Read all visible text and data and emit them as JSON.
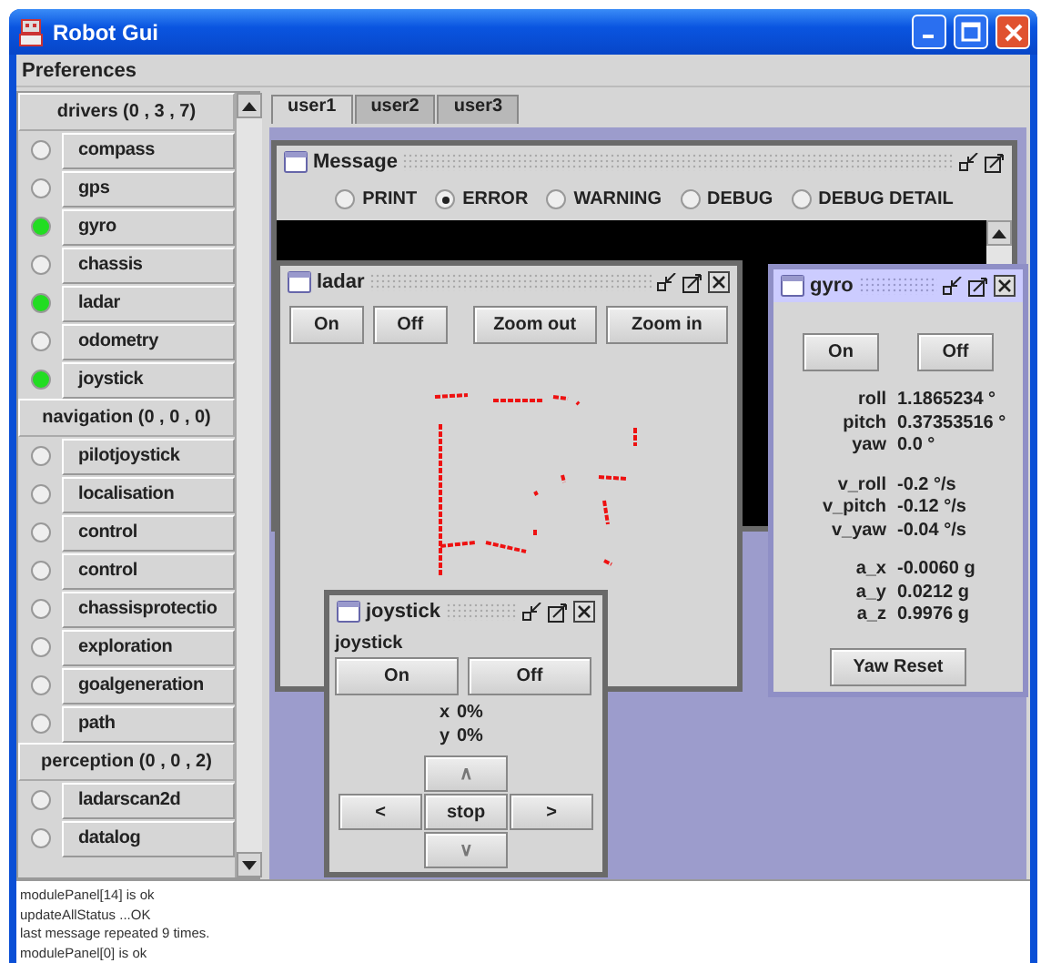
{
  "window": {
    "title": "Robot Gui"
  },
  "menu": [
    "Preferences"
  ],
  "module_groups": [
    {
      "title": "drivers (0 , 3 , 7)",
      "modules": [
        {
          "name": "compass",
          "running": false
        },
        {
          "name": "gps",
          "running": false
        },
        {
          "name": "gyro",
          "running": true
        },
        {
          "name": "chassis",
          "running": false
        },
        {
          "name": "ladar",
          "running": true
        },
        {
          "name": "odometry",
          "running": false
        },
        {
          "name": "joystick",
          "running": true
        }
      ]
    },
    {
      "title": "navigation (0 , 0 , 0)",
      "modules": [
        {
          "name": "pilotjoystick",
          "running": false
        },
        {
          "name": "localisation",
          "running": false
        },
        {
          "name": "control",
          "running": false
        },
        {
          "name": "control",
          "running": false
        },
        {
          "name": "chassisprotectio",
          "running": false
        },
        {
          "name": "exploration",
          "running": false
        },
        {
          "name": "goalgeneration",
          "running": false
        },
        {
          "name": "path",
          "running": false
        }
      ]
    },
    {
      "title": "perception (0 , 0 , 2)",
      "modules": [
        {
          "name": "ladarscan2d",
          "running": false
        },
        {
          "name": "datalog",
          "running": false
        }
      ]
    }
  ],
  "tabs": [
    {
      "label": "user1",
      "selected": true
    },
    {
      "label": "user2",
      "selected": false
    },
    {
      "label": "user3",
      "selected": false
    }
  ],
  "message_window": {
    "title": "Message",
    "active": false,
    "closable": false,
    "levels": [
      {
        "label": "PRINT",
        "selected": false
      },
      {
        "label": "ERROR",
        "selected": true
      },
      {
        "label": "WARNING",
        "selected": false
      },
      {
        "label": "DEBUG",
        "selected": false
      },
      {
        "label": "DEBUG DETAIL",
        "selected": false
      }
    ]
  },
  "ladar_window": {
    "title": "ladar",
    "active": false,
    "closable": true,
    "buttons": [
      "On",
      "Off",
      "Zoom out",
      "Zoom in"
    ]
  },
  "gyro_window": {
    "title": "gyro",
    "active": true,
    "closable": true,
    "buttons": [
      "On",
      "Off"
    ],
    "groups": [
      [
        {
          "label": "roll",
          "value": "1.1865234 °"
        },
        {
          "label": "pitch",
          "value": "0.37353516 °"
        },
        {
          "label": "yaw",
          "value": "0.0 °"
        }
      ],
      [
        {
          "label": "v_roll",
          "value": "-0.2 °/s"
        },
        {
          "label": "v_pitch",
          "value": "-0.12 °/s"
        },
        {
          "label": "v_yaw",
          "value": "-0.04 °/s"
        }
      ],
      [
        {
          "label": "a_x",
          "value": "-0.0060 g"
        },
        {
          "label": "a_y",
          "value": "0.0212 g"
        },
        {
          "label": "a_z",
          "value": "0.9976 g"
        }
      ]
    ],
    "reset_button": "Yaw Reset"
  },
  "joystick_window": {
    "title": "joystick",
    "active": false,
    "closable": true,
    "label": "joystick",
    "buttons": [
      "On",
      "Off"
    ],
    "readouts": [
      {
        "label": "x",
        "value": "0%"
      },
      {
        "label": "y",
        "value": "0%"
      }
    ],
    "pad": {
      "up": "∧",
      "left": "<",
      "stop": "stop",
      "right": ">",
      "down": "∨"
    }
  },
  "log": [
    "modulePanel[14] is ok",
    "updateAllStatus ...OK",
    "last message repeated 9 times.",
    "modulePanel[0] is ok"
  ]
}
